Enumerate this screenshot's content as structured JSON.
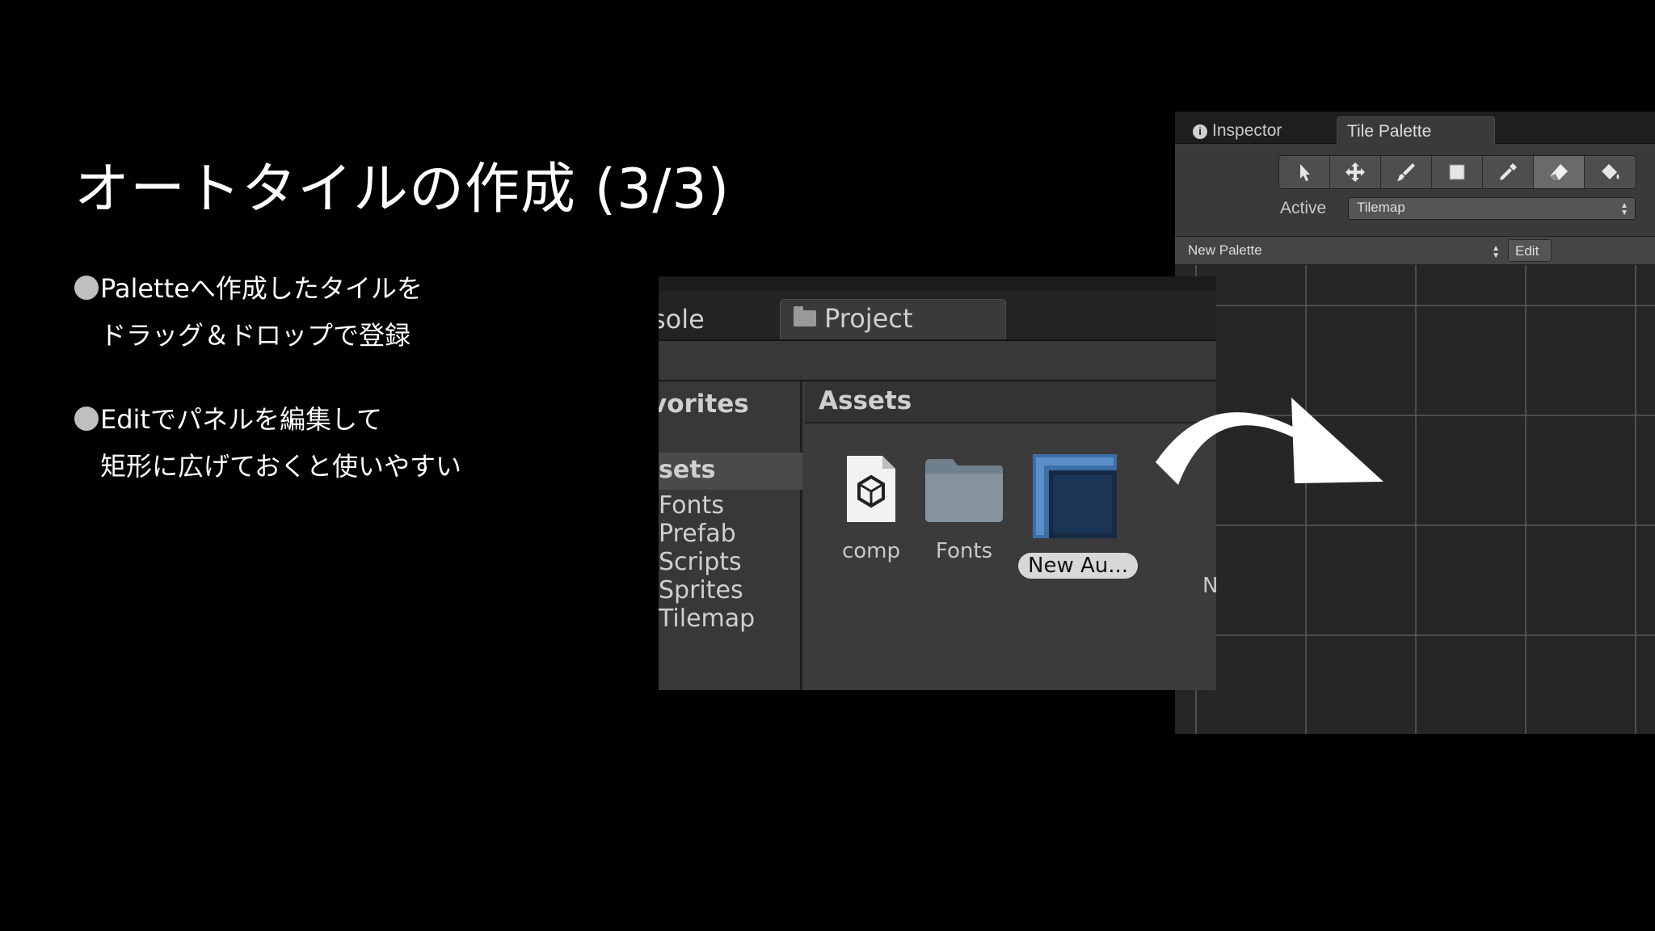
{
  "slide": {
    "title": "オートタイルの作成 (3/3)",
    "bullet1_line1": "Paletteへ作成したタイルを",
    "bullet1_line2": "ドラッグ＆ドロップで登録",
    "bullet2_line1": "Editでパネルを編集して",
    "bullet2_line2": "矩形に広げておくと使いやすい"
  },
  "tile_palette_window": {
    "tabs": {
      "inspector": "Inspector",
      "tile_palette": "Tile Palette"
    },
    "tools": [
      "select-icon",
      "move-icon",
      "brush-icon",
      "box-fill-icon",
      "picker-icon",
      "eraser-icon",
      "fill-icon"
    ],
    "active_tool_index": 5,
    "active_label": "Active",
    "active_value": "Tilemap",
    "palette_value": "New Palette",
    "edit_label": "Edit"
  },
  "project_window": {
    "tabs": {
      "console": "sole",
      "project": "Project"
    },
    "sidebar_header": "vorites",
    "sidebar_items": [
      "sets",
      "Fonts",
      "Prefab",
      "Scripts",
      "Sprites",
      "Tilemap"
    ],
    "selected_sidebar_index": 0,
    "main_header": "Assets",
    "assets": [
      {
        "label": "comp",
        "icon": "unity-file-icon"
      },
      {
        "label": "Fonts",
        "icon": "folder-icon"
      },
      {
        "label": "New Au...",
        "icon": "autotile-icon",
        "selected": true
      }
    ],
    "truncated_next": "N"
  },
  "colors": {
    "background": "#000000",
    "editor_dark": "#2a2a2a",
    "panel": "#3b3b3b",
    "tile_blue": "#2f5f9a"
  }
}
